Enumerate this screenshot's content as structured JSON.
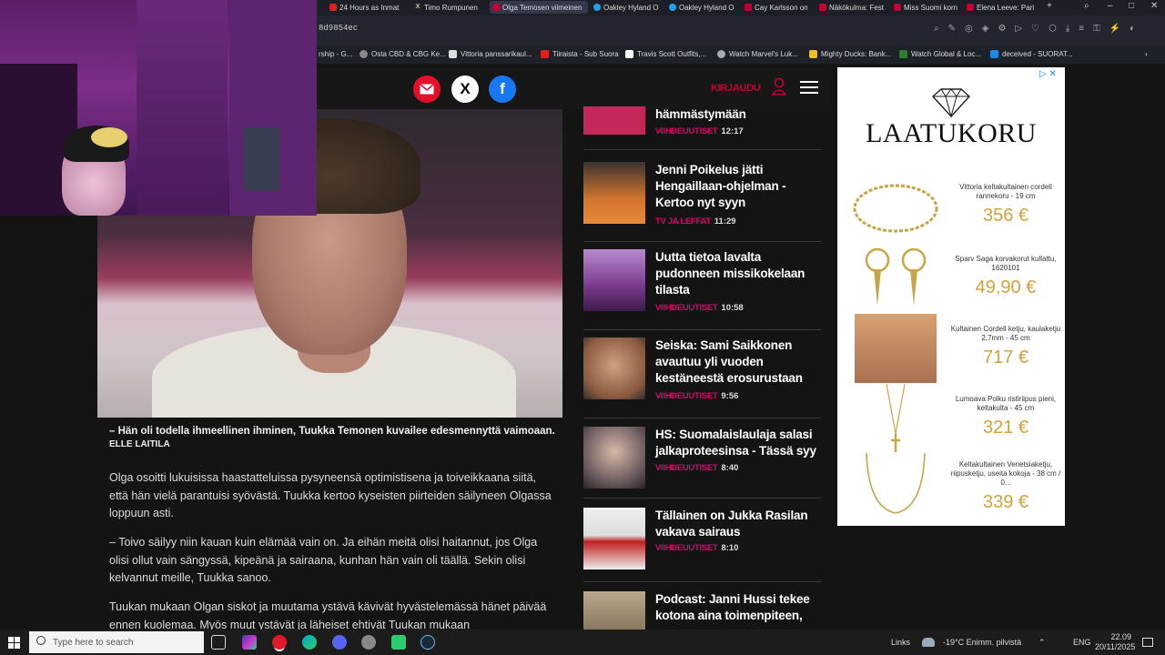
{
  "browser": {
    "tabs": [
      {
        "label": "24 Hours as Inmat",
        "color": "#e02020"
      },
      {
        "label": "Timo Rumpunen",
        "color": "#222222"
      },
      {
        "label": "Olga Temosen viimeinen",
        "color": "#c40035",
        "active": true
      },
      {
        "label": "Oakley Hyland O",
        "color": "#1da1f2"
      },
      {
        "label": "Oakley Hyland O",
        "color": "#1da1f2"
      },
      {
        "label": "Cay Karlsson on",
        "color": "#c40035"
      },
      {
        "label": "Näkökulma: Fest",
        "color": "#c40035"
      },
      {
        "label": "Miss Suomi korn",
        "color": "#c40035"
      },
      {
        "label": "Elena Leeve: Pari",
        "color": "#c40035"
      }
    ],
    "url": "8d9854ec",
    "bookmarks": [
      {
        "label": "rship - G...",
        "color": "#555555"
      },
      {
        "label": "Osta CBD & CBG Ke...",
        "color": "#888888"
      },
      {
        "label": "Vittoria panssarikaul...",
        "color": "#dddddd"
      },
      {
        "label": "Tiiraista - Sub Suora",
        "color": "#e02020"
      },
      {
        "label": "Travis Scott Outfits,...",
        "color": "#ffffff"
      },
      {
        "label": "Watch Marvel's Luk...",
        "color": "#aaaaaa"
      },
      {
        "label": "Mighty Ducks: Bank...",
        "color": "#f0c020"
      },
      {
        "label": "Watch Global & Loc...",
        "color": "#2e7d32"
      },
      {
        "label": "deceived - SUORAT...",
        "color": "#1e88e5"
      }
    ]
  },
  "header": {
    "login_label": "KIRJAUDU"
  },
  "article": {
    "caption": "– Hän oli todella ihmeellinen ihminen, Tuukka Temonen kuvailee edesmennyttä vaimoaan.",
    "credit": "ELLE LAITILA",
    "paragraphs": [
      "Olga osoitti lukuisissa haastatteluissa pysyneensä optimistisena ja toiveikkaana siitä, että hän vielä parantuisi syövästä. Tuukka kertoo kyseisten piirteiden säilyneen Olgassa loppuun asti.",
      "– Toivo säilyy niin kauan kuin elämää vain on. Ja eihän meitä olisi haitannut, jos Olga olisi ollut vain sängyssä, kipeänä ja sairaana, kunhan hän vain oli täällä. Sekin olisi kelvannut meille, Tuukka sanoo.",
      "Tuukan mukaan Olgan siskot ja muutama ystävä kävivät hyvästelemässä hänet päivää ennen kuolemaa. Myös muut ystävät ja läheiset ehtivät Tuukan mukaan"
    ]
  },
  "news": [
    {
      "title": "hämmästymään",
      "category": "VIIHDEUUTISET",
      "time": "12:17",
      "color": "#c4285a"
    },
    {
      "title": "Jenni Poikelus jätti Hengaillaan-ohjelman - Kertoo nyt syyn",
      "category": "TV JA LEFFAT",
      "time": "11:29",
      "color": "#d2752e"
    },
    {
      "title": "Uutta tietoa lavalta pudonneen missikokelaan tilasta",
      "category": "VIIHDEUUTISET",
      "time": "10:58",
      "color": "#7a3a8c"
    },
    {
      "title": "Seiska: Sami Saikkonen avautuu yli vuoden kestäneestä erosurustaan",
      "category": "VIIHDEUUTISET",
      "time": "9:56",
      "color": "#a0704e"
    },
    {
      "title": "HS: Suomalaislaulaja salasi jalkaproteesinsa - Tässä syy",
      "category": "VIIHDEUUTISET",
      "time": "8:40",
      "color": "#6a5a5e"
    },
    {
      "title": "Tällainen on Jukka Rasilan vakava sairaus",
      "category": "VIIHDEUUTISET",
      "time": "8:10",
      "color": "#e8e0d8"
    },
    {
      "title": "Podcast: Janni Hussi tekee kotona aina toimenpiteen,",
      "category": "",
      "time": "",
      "color": "#8a7a62"
    }
  ],
  "ad": {
    "brand": "LAATUKORU",
    "products": [
      {
        "name": "Vittoria keltakultainen cordell rannekoru - 19 cm",
        "price": "356 €"
      },
      {
        "name": "Sparv Saga korvakorut kullattu, 1620101",
        "price": "49,90 €"
      },
      {
        "name": "Kultainen Cordell ketju, kaulaketju 2,7mm - 45 cm",
        "price": "717 €"
      },
      {
        "name": "Lumoava Polku ristiriipus pieni, keltakulta - 45 cm",
        "price": "321 €"
      },
      {
        "name": "Keltakultainen Venetsiaketju, riipusketju, useita kokoja - 38 cm / 0...",
        "price": "339 €"
      }
    ]
  },
  "taskbar": {
    "search_placeholder": "Type here to search",
    "links": "Links",
    "weather": "-19°C  Enimm. pilvistä",
    "lang": "ENG",
    "time": "22.09",
    "date": "20/11/2025"
  }
}
